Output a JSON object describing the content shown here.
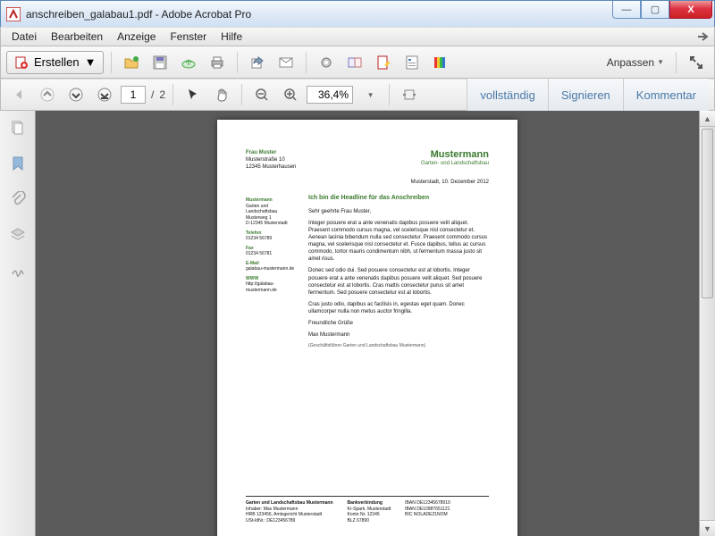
{
  "window": {
    "title": "anschreiben_galabau1.pdf - Adobe Acrobat Pro",
    "min": "—",
    "max": "▢",
    "close": "X"
  },
  "menu": {
    "items": [
      "Datei",
      "Bearbeiten",
      "Anzeige",
      "Fenster",
      "Hilfe"
    ]
  },
  "toolbar1": {
    "create_label": "Erstellen",
    "anpassen": "Anpassen"
  },
  "toolbar2": {
    "page_current": "1",
    "page_sep": "/",
    "page_total": "2",
    "zoom": "36,4%",
    "right_tabs": [
      "vollständig",
      "Signieren",
      "Kommentar"
    ]
  },
  "nav_icons": [
    "pages-icon",
    "bookmarks-icon",
    "attachments-icon",
    "layers-icon",
    "signatures-icon"
  ],
  "document": {
    "recipient": {
      "name": "Frau Muster",
      "street": "Musterstraße 10",
      "city": "12345 Musterhausen"
    },
    "brand": {
      "name": "Mustermann",
      "sub": "Garten- und Landschaftsbau"
    },
    "date": "Musterstadt, 10. Dezember 2012",
    "sidebar": {
      "h1": "Mustermann",
      "l1a": "Garten und Landschaftsbau",
      "l1b": "Musterweg 1",
      "l1c": "D-12345 Musterstadt",
      "h2": "Telefon",
      "l2": "01234 56789",
      "h3": "Fax",
      "l3": "01234 56781",
      "h4": "E-Mail",
      "l4": "galabau-mustermann.de",
      "h5": "WWW",
      "l5": "http://galabau-mustermann.de"
    },
    "body": {
      "headline": "Ich bin die Headline für das Anschreiben",
      "salutation": "Sehr geehrte Frau Muster,",
      "p1": "Integer posuere erat a ante venenatis dapibus posuere velit aliquet. Praesent commodo cursus magna, vel scelerisque nisl consectetur et. Aenean lacinia bibendum nulla sed consectetur. Praesent commodo cursus magna, vel scelerisque nisl consectetur et. Fusce dapibus, tellus ac cursus commodo, tortor mauris condimentum nibh, ut fermentum massa justo sit amet risus.",
      "p2": "Donec sed odio dui. Sed posuere consectetur est at lobortis. Integer posuere erat a ante venenatis dapibus posuere velit aliquet. Sed posuere consectetur est at lobortis. Cras mattis consectetur purus sit amet fermentum. Sed posuere consectetur est at lobortis.",
      "p3": "Cras justo odio, dapibus ac facilisis in, egestas eget quam. Donec ullamcorper nulla non metus auctor fringilla.",
      "closing": "Freundliche Grüße",
      "sig_name": "Max Mustermann",
      "sig_role": "(Geschäftsführer Garten und Landschaftsbau Mustermann)"
    },
    "footer": {
      "col1": {
        "h": "Garten und Landschaftsbau Mustermann",
        "l1": "Inhaber: Max Mustermann",
        "l2": "HRB 123456, Amtsgericht Musterstadt",
        "l3": "USt-IdNr.: DE123456789"
      },
      "col2": {
        "h": "Bankverbindung",
        "l1": "Kr-Spark. Musterstadt",
        "l2": "Konto Nr. 12345",
        "l3": "BLZ 67890"
      },
      "col3": {
        "l1": "IBAN DE12345678910",
        "l2": "IBAN DE10987651121",
        "l3": "BIC NOLADE21NOM"
      }
    }
  }
}
